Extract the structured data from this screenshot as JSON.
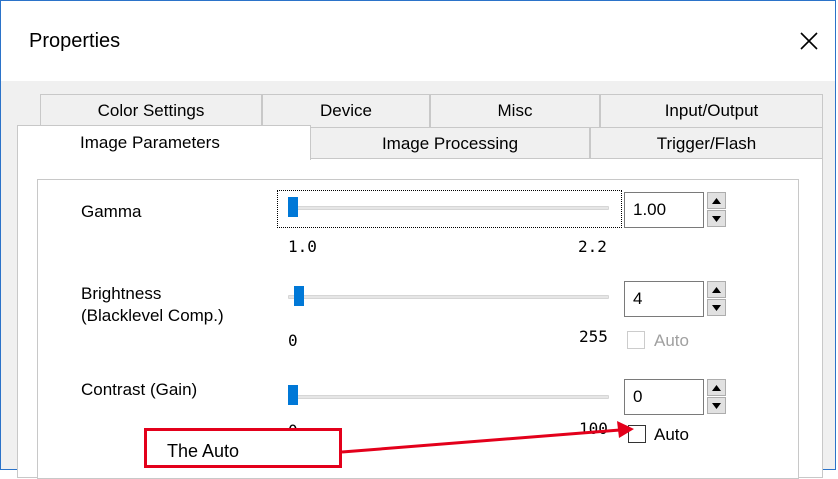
{
  "window": {
    "title": "Properties",
    "close_icon": "close-icon"
  },
  "tabs": {
    "row1": [
      {
        "label": "Color Settings"
      },
      {
        "label": "Device"
      },
      {
        "label": "Misc"
      },
      {
        "label": "Input/Output"
      }
    ],
    "row2": [
      {
        "label": "Image Parameters",
        "active": true
      },
      {
        "label": "Image Processing"
      },
      {
        "label": "Trigger/Flash"
      }
    ]
  },
  "params": {
    "gamma": {
      "label": "Gamma",
      "min": "1.0",
      "max": "2.2",
      "value": "1.00"
    },
    "brightness": {
      "label_line1": "Brightness",
      "label_line2": "(Blacklevel Comp.)",
      "min": "0",
      "max": "255",
      "value": "4",
      "auto_label": "Auto",
      "auto_enabled": false,
      "auto_checked": false
    },
    "contrast": {
      "label": "Contrast (Gain)",
      "min": "0",
      "max": "100",
      "value": "0",
      "auto_label": "Auto",
      "auto_checked": false
    }
  },
  "annotation": {
    "text": "The Auto",
    "color": "#e3001b"
  },
  "colors": {
    "accent": "#0078d7",
    "window_border": "#2b73c9"
  }
}
